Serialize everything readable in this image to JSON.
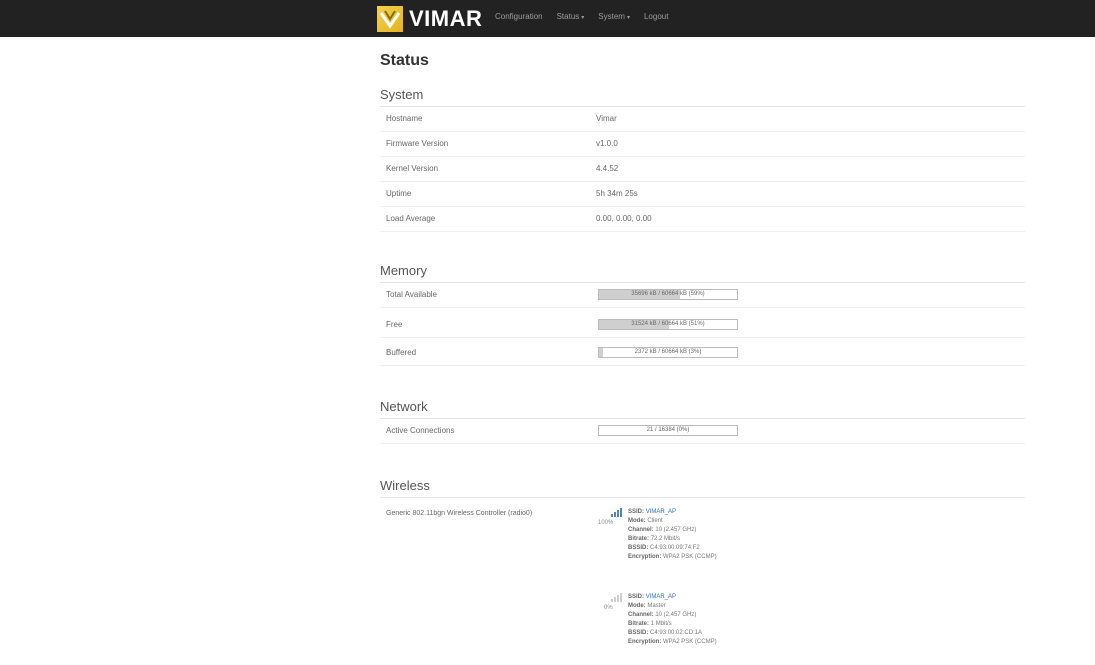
{
  "brand": "VIMAR",
  "nav": [
    {
      "label": "Configuration",
      "caret": ""
    },
    {
      "label": "Status",
      "caret": "▾"
    },
    {
      "label": "System",
      "caret": "▾"
    },
    {
      "label": "Logout",
      "caret": ""
    }
  ],
  "page_title": "Status",
  "system": {
    "title": "System",
    "rows": [
      {
        "label": "Hostname",
        "value": "Vimar"
      },
      {
        "label": "Firmware Version",
        "value": "v1.0.0"
      },
      {
        "label": "Kernel Version",
        "value": "4.4.52"
      },
      {
        "label": "Uptime",
        "value": "5h 34m 25s"
      },
      {
        "label": "Load Average",
        "value": "0.00, 0.00, 0.00"
      }
    ]
  },
  "memory": {
    "title": "Memory",
    "rows": [
      {
        "label": "Total Available",
        "text": "35696 kB / 60664 kB (59%)",
        "fraction": 0.59
      },
      {
        "label": "Free",
        "text": "31524 kB / 60664 kB (51%)",
        "fraction": 0.51
      },
      {
        "label": "Buffered",
        "text": "2372 kB / 60664 kB (3%)",
        "fraction": 0.03
      }
    ]
  },
  "network": {
    "title": "Network",
    "rows": [
      {
        "label": "Active Connections",
        "text": "21 / 16384 (0%)",
        "fraction": 0.0
      }
    ]
  },
  "wireless": {
    "title": "Wireless",
    "controller": "Generic 802.11bgn Wireless Controller (radio0)",
    "networks": [
      {
        "signal": "100%",
        "ssid_label": "SSID:",
        "ssid": "VIMAR_AP",
        "mode_label": "Mode:",
        "mode": "Client",
        "channel_label": "Channel:",
        "channel": "10 (2.457 GHz)",
        "bitrate_label": "Bitrate:",
        "bitrate": "72.2 Mbit/s",
        "bssid_label": "BSSID:",
        "bssid": "C4:93:00:09:74:F2",
        "encryption_label": "Encryption:",
        "encryption": "WPA2 PSK (CCMP)"
      },
      {
        "signal": "0%",
        "ssid_label": "SSID:",
        "ssid": "VIMAR_AP",
        "mode_label": "Mode:",
        "mode": "Master",
        "channel_label": "Channel:",
        "channel": "10 (2.457 GHz)",
        "bitrate_label": "Bitrate:",
        "bitrate": "1 Mbit/s",
        "bssid_label": "BSSID:",
        "bssid": "C4:93:00:02:CD:1A",
        "encryption_label": "Encryption:",
        "encryption": "WPA2 PSK (CCMP)"
      }
    ]
  },
  "colors": {
    "navbar": "#222222",
    "logo": "#f4d24a",
    "link": "#2a6fb0",
    "bar_fill": "#cfcfcf"
  }
}
